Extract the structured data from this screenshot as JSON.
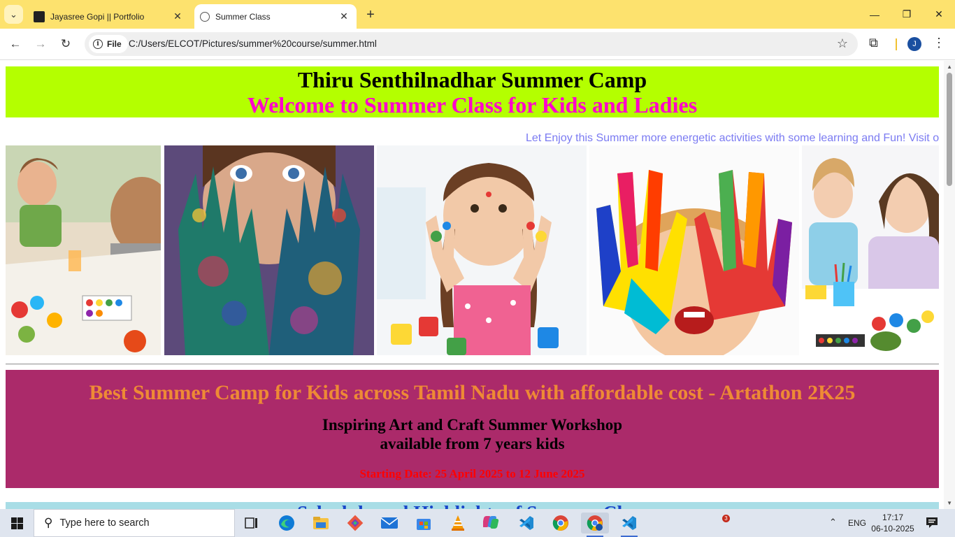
{
  "browser": {
    "tabs": [
      {
        "title": "Jayasree Gopi || Portfolio",
        "active": false
      },
      {
        "title": "Summer Class",
        "active": true
      }
    ],
    "omnibox": {
      "chip_label": "File",
      "url": "C:/Users/ELCOT/Pictures/summer%20course/summer.html"
    },
    "profile_initial": "J"
  },
  "page": {
    "header": {
      "title": "Thiru Senthilnadhar Summer Camp",
      "subtitle": "Welcome to Summer Class for Kids and Ladies"
    },
    "marquee_text": "Let Enjoy this Summer more energetic activities with some learning and Fun! Visit o",
    "gallery": [
      {
        "name": "kids-painting-photo"
      },
      {
        "name": "painted-hands-girl-photo"
      },
      {
        "name": "girl-painted-hands-photo"
      },
      {
        "name": "boy-rainbow-hands-photo"
      },
      {
        "name": "mother-daughter-crafts-photo"
      }
    ],
    "promo": {
      "title": "Best Summer Camp for Kids across Tamil Nadu with affordable cost - Artathon 2K25",
      "subtitle_line1": "Inspiring Art and Craft Summer Workshop",
      "subtitle_line2": "available from 7 years kids",
      "date": "Starting Date: 25 April 2025 to 12 June 2025"
    },
    "next_section_partial": "Schedule and Highlights of Summer Class"
  },
  "taskbar": {
    "search_placeholder": "Type here to search",
    "notification_count": "3",
    "language": "ENG",
    "time": "17:17",
    "date": "06-10-2025",
    "apps": [
      "task-view",
      "edge",
      "file-explorer",
      "git",
      "mail",
      "store",
      "vlc",
      "microsoft-365",
      "vscode",
      "chrome",
      "chrome-profile",
      "vscode-active"
    ]
  },
  "colors": {
    "tabstrip": "#fde26e",
    "header_bg": "#b4ff00",
    "header_sub": "#ff00cc",
    "marquee": "#7b7bf2",
    "promo_bg": "#ab2a6a",
    "promo_title": "#ee8a35",
    "promo_date": "#ff0000",
    "next_bg": "#a8dde6",
    "next_text": "#1846c9"
  }
}
